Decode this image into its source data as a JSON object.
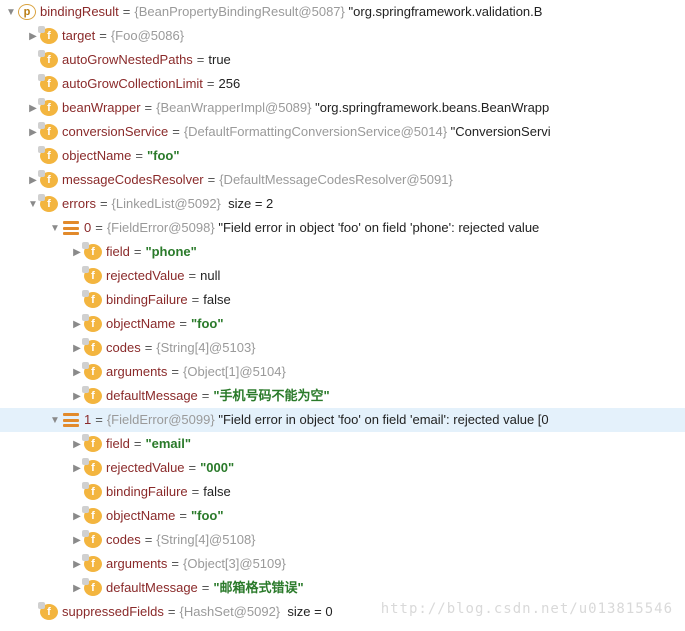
{
  "root": {
    "name": "bindingResult",
    "type": "{BeanPropertyBindingResult@5087}",
    "display": "\"org.springframework.validation.B"
  },
  "target": {
    "name": "target",
    "value": "{Foo@5086}"
  },
  "autoGrowNestedPaths": {
    "name": "autoGrowNestedPaths",
    "value": "true"
  },
  "autoGrowCollectionLimit": {
    "name": "autoGrowCollectionLimit",
    "value": "256"
  },
  "beanWrapper": {
    "name": "beanWrapper",
    "type": "{BeanWrapperImpl@5089}",
    "display": "\"org.springframework.beans.BeanWrapp"
  },
  "conversionService": {
    "name": "conversionService",
    "type": "{DefaultFormattingConversionService@5014}",
    "display": "\"ConversionServi"
  },
  "objectName": {
    "name": "objectName",
    "value": "\"foo\""
  },
  "messageCodesResolver": {
    "name": "messageCodesResolver",
    "value": "{DefaultMessageCodesResolver@5091}"
  },
  "errors": {
    "name": "errors",
    "type": "{LinkedList@5092}",
    "sizeLabel": "size = 2",
    "items": [
      {
        "index": "0",
        "type": "{FieldError@5098}",
        "display": "\"Field error in object 'foo' on field 'phone': rejected value",
        "field": {
          "name": "field",
          "value": "\"phone\""
        },
        "rejectedValue": {
          "name": "rejectedValue",
          "value": "null"
        },
        "bindingFailure": {
          "name": "bindingFailure",
          "value": "false"
        },
        "objectName": {
          "name": "objectName",
          "value": "\"foo\""
        },
        "codes": {
          "name": "codes",
          "value": "{String[4]@5103}"
        },
        "arguments": {
          "name": "arguments",
          "value": "{Object[1]@5104}"
        },
        "defaultMessage": {
          "name": "defaultMessage",
          "value": "\"手机号码不能为空\""
        }
      },
      {
        "index": "1",
        "type": "{FieldError@5099}",
        "display": "\"Field error in object 'foo' on field 'email': rejected value [0",
        "field": {
          "name": "field",
          "value": "\"email\""
        },
        "rejectedValue": {
          "name": "rejectedValue",
          "value": "\"000\""
        },
        "bindingFailure": {
          "name": "bindingFailure",
          "value": "false"
        },
        "objectName": {
          "name": "objectName",
          "value": "\"foo\""
        },
        "codes": {
          "name": "codes",
          "value": "{String[4]@5108}"
        },
        "arguments": {
          "name": "arguments",
          "value": "{Object[3]@5109}"
        },
        "defaultMessage": {
          "name": "defaultMessage",
          "value": "\"邮箱格式错误\""
        }
      }
    ]
  },
  "suppressedFields": {
    "name": "suppressedFields",
    "type": "{HashSet@5092}",
    "sizeLabel": "size = 0"
  },
  "watermark": "http://blog.csdn.net/u013815546"
}
